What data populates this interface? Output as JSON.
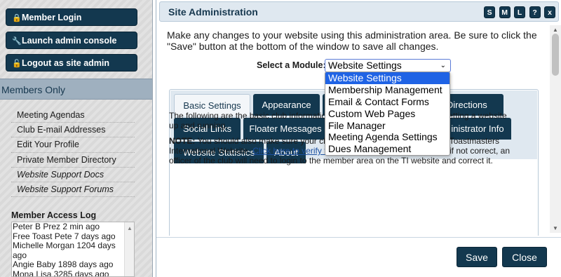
{
  "sidebar": {
    "buttons": [
      {
        "icon": "lock-icon",
        "glyph": "🔒",
        "label": "Member Login"
      },
      {
        "icon": "wrench-icon",
        "glyph": "🔧",
        "label": "Launch admin console"
      },
      {
        "icon": "unlock-icon",
        "glyph": "🔓",
        "label": "Logout as site admin"
      }
    ],
    "section_title": "Members Only",
    "links": [
      "Meeting Agendas",
      "Club E-mail Addresses",
      "Edit Your Profile",
      "Private Member Directory",
      "Website Support Docs",
      "Website Support Forums"
    ],
    "access_log_title": "Member Access Log",
    "access_log": [
      "Peter B Prez 2 min ago",
      "Free Toast Pete 7 days ago",
      "Michelle Morgan 1204 days ago",
      "Angie Baby 1898 days ago",
      "Mona Lisa 3285 days ago"
    ]
  },
  "modal": {
    "title": "Site Administration",
    "header_buttons": [
      "S",
      "M",
      "L",
      "?",
      "x"
    ],
    "intro": "Make any changes to your website using this administration area. Be sure to click the \"Save\" button at the bottom of the window to save all changes.",
    "module_label": "Select a Module:",
    "module_value": "Website Settings",
    "module_options": [
      "Website Settings",
      "Membership Management",
      "Email & Contact Forms",
      "Custom Web Pages",
      "File Manager",
      "Meeting Agenda Settings",
      "Dues Management"
    ],
    "tabs": [
      "Basic Settings",
      "Appearance",
      "/Directions",
      "Social Links",
      "Floater Messages",
      "inistrator Info",
      "Website Statistics",
      "About"
    ],
    "content": {
      "para1": "The following are the basic club information and configuration settings for getting a website up and running.",
      "note_label": "NOTE:",
      "note_text": " You should also make sure your club's information is current on the Toastmasters International Website. ",
      "note_link": "Click here to verify the information for your club",
      "note_tail": ", and if not correct, an officer of the club will need to login to the member area on the TI website and correct it."
    },
    "footer": {
      "save": "Save",
      "close": "Close"
    }
  }
}
